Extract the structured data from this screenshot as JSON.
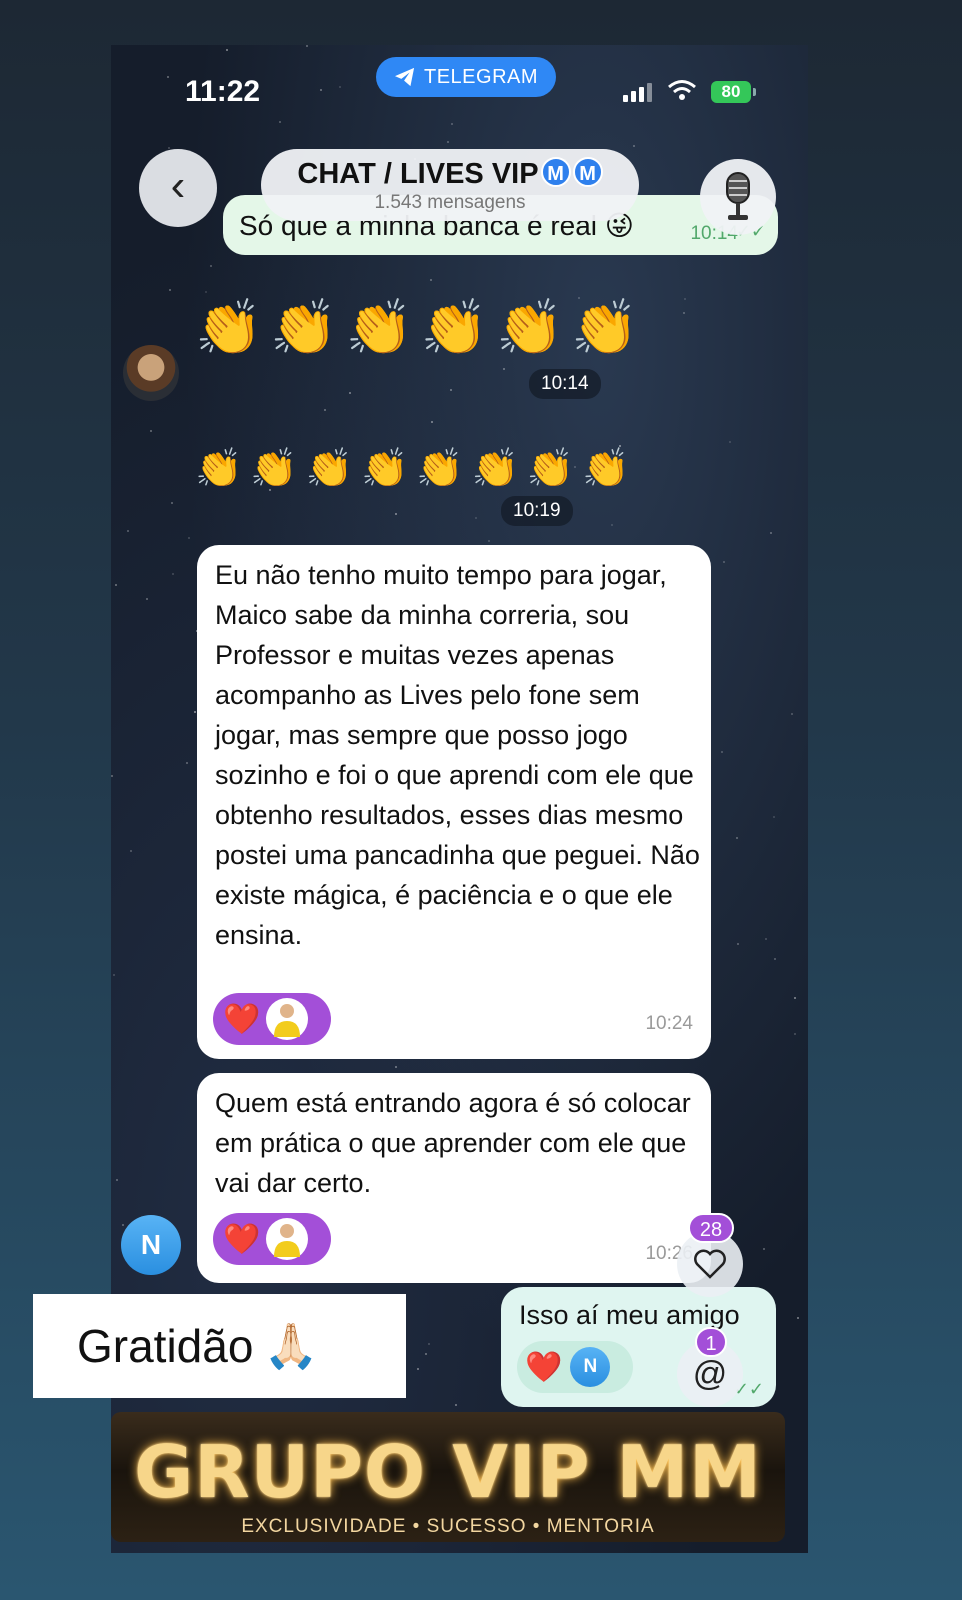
{
  "status_bar": {
    "time": "11:22",
    "app_label": "TELEGRAM",
    "battery": "80"
  },
  "header": {
    "back_label": "‹",
    "title": "CHAT / LIVES VIP",
    "badges": [
      "M",
      "M"
    ],
    "subtitle": "1.543 mensagens"
  },
  "messages": [
    {
      "id": "m1",
      "type": "outgoing",
      "text": "Só que a minha banca é real 😜",
      "time": "10:14"
    },
    {
      "id": "m2",
      "type": "emoji",
      "text": "👏👏👏👏👏👏",
      "time": "10:14"
    },
    {
      "id": "m3",
      "type": "emoji",
      "text": "👏👏👏👏👏👏👏👏",
      "time": "10:19"
    },
    {
      "id": "m4",
      "type": "incoming",
      "text": "Eu não tenho muito tempo para jogar, Maico sabe da minha correria, sou Professor e muitas vezes apenas acompanho as Lives pelo fone sem jogar, mas sempre que posso jogo sozinho e foi o que aprendi com ele que obtenho resultados, esses dias mesmo postei uma pancadinha que peguei. Não existe mágica, é paciência e o que ele ensina.",
      "time": "10:24",
      "reaction": "❤️"
    },
    {
      "id": "m5",
      "type": "incoming",
      "text": "Quem está entrando agora é só colocar em prática o que aprender com ele que vai dar certo.",
      "time": "10:26",
      "reaction": "❤️",
      "sender_initial": "N"
    },
    {
      "id": "m6",
      "type": "outgoing",
      "text": "Isso aí meu amigo",
      "reaction": "❤️",
      "reactor_initial": "N"
    }
  ],
  "floating": {
    "reactions_count": "28",
    "mentions_count": "1",
    "mention_symbol": "@"
  },
  "overlay_caption": {
    "text": "Gratidão",
    "emoji": "🙏🏻"
  },
  "banner": {
    "title": "GRUPO VIP MM",
    "subtitle": "EXCLUSIVIDADE • SUCESSO • MENTORIA"
  },
  "colors": {
    "accent_blue": "#2f88f5",
    "reaction_purple": "#a34fd8",
    "outgoing_bubble": "#e4f7e8",
    "battery_green": "#34c759"
  }
}
